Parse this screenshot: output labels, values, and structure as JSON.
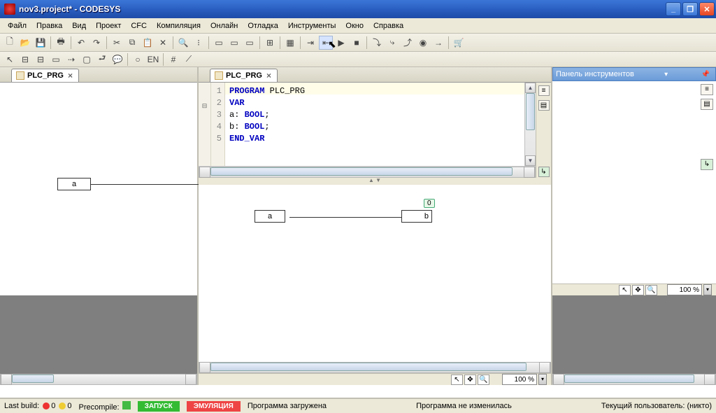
{
  "window": {
    "title": "nov3.project* - CODESYS"
  },
  "menu": {
    "file": "Файл",
    "edit": "Правка",
    "view": "Вид",
    "project": "Проект",
    "cfc": "CFC",
    "compile": "Компиляция",
    "online": "Онлайн",
    "debug": "Отладка",
    "tools": "Инструменты",
    "window": "Окно",
    "help": "Справка"
  },
  "tabs": {
    "left": "PLC_PRG",
    "center": "PLC_PRG"
  },
  "code": {
    "lines": [
      "1",
      "2",
      "3",
      "4",
      "5"
    ],
    "l1a": "PROGRAM",
    "l1b": " PLC_PRG",
    "l2": "VAR",
    "l3a": "    a: ",
    "l3b": "BOOL",
    "l3c": ";",
    "l4a": "    b: ",
    "l4b": "BOOL",
    "l4c": ";",
    "l5": "END_VAR"
  },
  "left_diagram": {
    "a": "a"
  },
  "center_diagram": {
    "a": "a",
    "b": "b",
    "badge": "0"
  },
  "right_panel": {
    "title": "Панель инструментов"
  },
  "zoom": {
    "value": "100 %"
  },
  "right_zoom": {
    "value": "100 %"
  },
  "status": {
    "lastbuild": "Last build:",
    "err": "0",
    "warn": "0",
    "precompile": "Precompile:",
    "run": "ЗАПУСК",
    "emu": "ЭМУЛЯЦИЯ",
    "loaded": "Программа загружена",
    "unchanged": "Программа не изменилась",
    "user": "Текущий пользователь: (никто)"
  }
}
